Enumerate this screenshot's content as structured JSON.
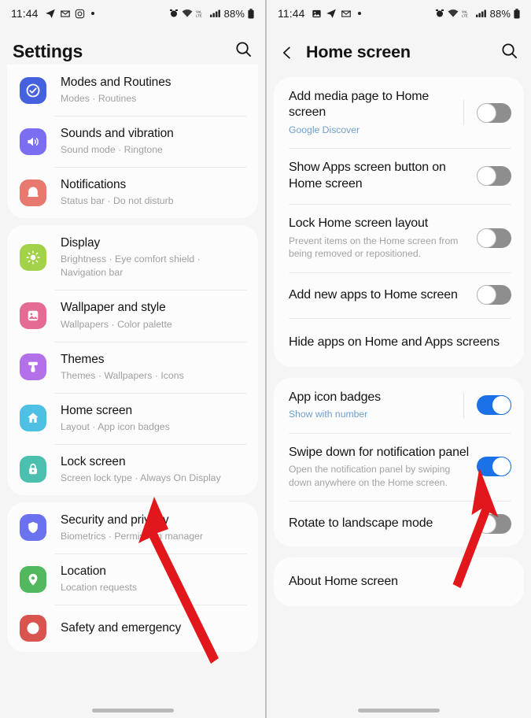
{
  "left_phone": {
    "status_bar": {
      "time": "11:44",
      "left_icons": [
        "telegram-icon",
        "mail-icon",
        "instagram-icon",
        "dot-icon"
      ],
      "right_icons": [
        "alarm-icon",
        "wifi-icon",
        "volte-icon",
        "signal-icon"
      ],
      "battery": "88%"
    },
    "header": {
      "title": "Settings",
      "search_icon": "search-icon"
    },
    "groups": [
      {
        "items": [
          {
            "title": "Modes and Routines",
            "subtitle": "Modes  ·  Routines",
            "icon": "modes-routines-icon",
            "color": "#4661dd"
          },
          {
            "title": "Sounds and vibration",
            "subtitle": "Sound mode  ·  Ringtone",
            "icon": "sound-icon",
            "color": "#7b6ef0"
          },
          {
            "title": "Notifications",
            "subtitle": "Status bar  ·  Do not disturb",
            "icon": "notifications-icon",
            "color": "#e8796e"
          }
        ]
      },
      {
        "items": [
          {
            "title": "Display",
            "subtitle": "Brightness  ·  Eye comfort shield  ·  Navigation bar",
            "icon": "display-icon",
            "color": "#a2d14a"
          },
          {
            "title": "Wallpaper and style",
            "subtitle": "Wallpapers  ·  Color palette",
            "icon": "wallpaper-icon",
            "color": "#e46b93"
          },
          {
            "title": "Themes",
            "subtitle": "Themes  ·  Wallpapers  ·  Icons",
            "icon": "themes-icon",
            "color": "#b470e8"
          },
          {
            "title": "Home screen",
            "subtitle": "Layout  ·  App icon badges",
            "icon": "home-icon",
            "color": "#4ec0e3"
          },
          {
            "title": "Lock screen",
            "subtitle": "Screen lock type  ·  Always On Display",
            "icon": "lock-icon",
            "color": "#4cbfae"
          }
        ]
      },
      {
        "items": [
          {
            "title": "Security and privacy",
            "subtitle": "Biometrics  ·  Permission manager",
            "icon": "shield-icon",
            "color": "#6b72f0"
          },
          {
            "title": "Location",
            "subtitle": "Location requests",
            "icon": "location-icon",
            "color": "#52b85e"
          },
          {
            "title": "Safety and emergency",
            "subtitle": "",
            "icon": "safety-icon",
            "color": "#d9534f"
          }
        ]
      }
    ]
  },
  "right_phone": {
    "status_bar": {
      "time": "11:44",
      "left_icons": [
        "gallery-icon",
        "telegram-icon",
        "mail-icon",
        "dot-icon"
      ],
      "right_icons": [
        "alarm-icon",
        "wifi-icon",
        "volte-icon",
        "signal-icon"
      ],
      "battery": "88%"
    },
    "header": {
      "title": "Home screen",
      "back_icon": "chevron-left-icon",
      "search_icon": "search-icon"
    },
    "settings": [
      {
        "title": "Add media page to Home screen",
        "subtitle": "Google Discover",
        "subtitle_style": "link",
        "toggle": "off",
        "divider_before_toggle": true
      },
      {
        "title": "Show Apps screen button on Home screen",
        "subtitle": "",
        "toggle": "off"
      },
      {
        "title": "Lock Home screen layout",
        "subtitle": "Prevent items on the Home screen from being removed or repositioned.",
        "toggle": "off"
      },
      {
        "title": "Add new apps to Home screen",
        "subtitle": "",
        "toggle": "off"
      },
      {
        "title": "Hide apps on Home and Apps screens",
        "subtitle": "",
        "toggle": "none"
      }
    ],
    "settings_group_2": [
      {
        "title": "App icon badges",
        "subtitle": "Show with number",
        "subtitle_style": "link",
        "toggle": "on",
        "divider_before_toggle": true
      },
      {
        "title": "Swipe down for notification panel",
        "subtitle": "Open the notification panel by swiping down anywhere on the Home screen.",
        "toggle": "on"
      },
      {
        "title": "Rotate to landscape mode",
        "subtitle": "",
        "toggle": "off"
      }
    ],
    "settings_group_3": [
      {
        "title": "About Home screen",
        "subtitle": "",
        "toggle": "none"
      }
    ]
  },
  "annotations": {
    "color": "#e2171b",
    "arrows": [
      {
        "name": "arrow-pointing-home-screen",
        "panel": "left"
      },
      {
        "name": "arrow-pointing-app-icon-badges-toggle",
        "panel": "right"
      }
    ]
  }
}
